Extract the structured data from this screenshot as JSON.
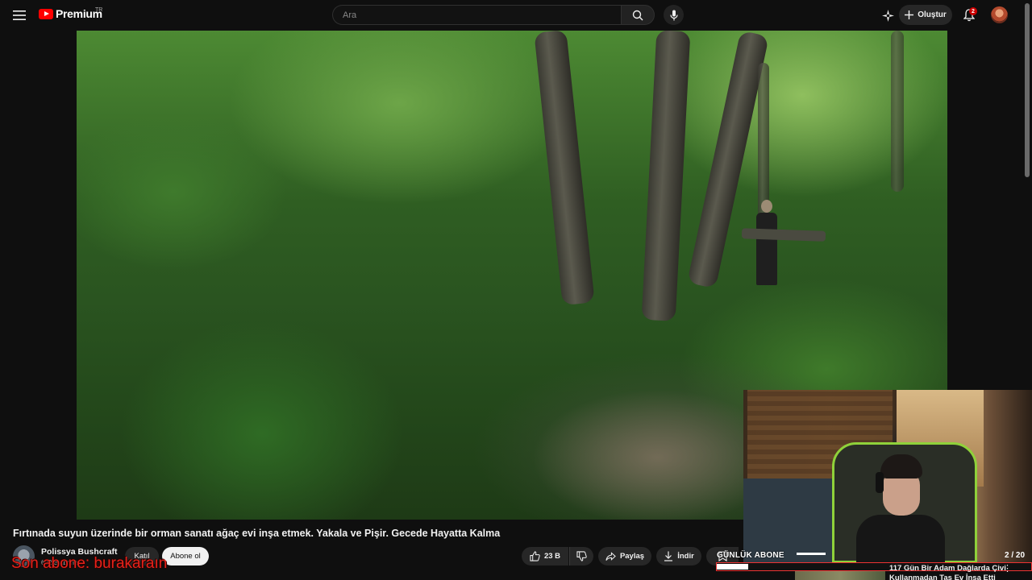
{
  "header": {
    "logo_text": "Premium",
    "country_code": "TR",
    "search_placeholder": "Ara",
    "create_label": "Oluştur",
    "notification_count": "2",
    "icons": {
      "menu": "hamburger-menu-icon",
      "search": "search-icon",
      "mic": "microphone-icon",
      "spark": "sparkle-icon",
      "create": "plus-icon",
      "bell": "bell-icon"
    }
  },
  "video": {
    "title": "Fırtınada suyun üzerinde bir orman sanatı ağaç evi inşa etmek. Yakala ve Pişir. Gecede Hayatta Kalma"
  },
  "channel": {
    "name": "Polissya Bushcraft",
    "subscribers": "682 B abone",
    "join_label": "Katıl",
    "subscribe_label": "Abone ol"
  },
  "actions": {
    "like_count": "23 B",
    "share_label": "Paylaş",
    "download_label": "İndir"
  },
  "stream_overlay": {
    "goal_label": "GÜNLÜK ABONE",
    "goal_count": "2 / 20",
    "goal_progress": 0.1,
    "last_subscriber_text": "Son abone: burakaraın"
  },
  "next_video": {
    "title_line1": "117 Gün Bir Adam Dağlarda Çivi",
    "title_line2": "Kullanmadan Taş Ev İnşa Etti"
  },
  "colors": {
    "background": "#0f0f0f",
    "brand_red": "#ff0000",
    "overlay_red": "#e4231b",
    "webcam_chair_accent": "#8fd13a"
  }
}
